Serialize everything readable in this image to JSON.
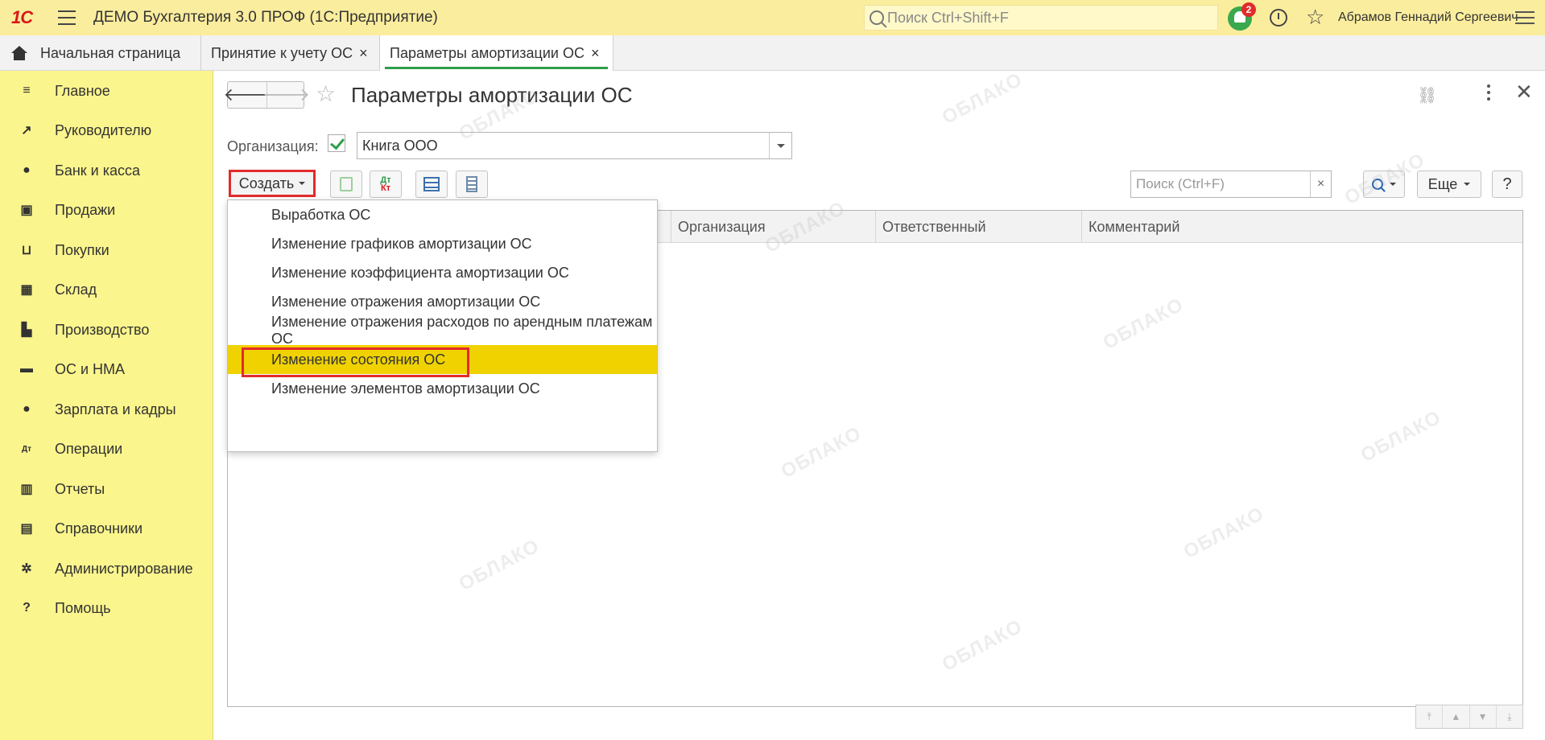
{
  "topbar": {
    "logo": "1С",
    "app_title": "ДЕМО Бухгалтерия 3.0 ПРОФ  (1С:Предприятие)",
    "search_placeholder": "Поиск Ctrl+Shift+F",
    "notifications_count": "2",
    "user_name": "Абрамов Геннадий Сергеевич"
  },
  "tabs": [
    {
      "label": "Начальная страница"
    },
    {
      "label": "Принятие к учету ОС",
      "close": "×"
    },
    {
      "label": "Параметры амортизации ОС",
      "close": "×",
      "active": true
    }
  ],
  "sidebar": {
    "items": [
      {
        "label": "Главное",
        "icon": "menu-icon"
      },
      {
        "label": "Руководителю",
        "icon": "trend-icon"
      },
      {
        "label": "Банк и касса",
        "icon": "coin-icon"
      },
      {
        "label": "Продажи",
        "icon": "bag-icon"
      },
      {
        "label": "Покупки",
        "icon": "cart-icon"
      },
      {
        "label": "Склад",
        "icon": "grid-icon"
      },
      {
        "label": "Производство",
        "icon": "factory-icon"
      },
      {
        "label": "ОС и НМА",
        "icon": "truck-icon"
      },
      {
        "label": "Зарплата и кадры",
        "icon": "person-icon"
      },
      {
        "label": "Операции",
        "icon": "dt-kt-icon"
      },
      {
        "label": "Отчеты",
        "icon": "bar-chart-icon"
      },
      {
        "label": "Справочники",
        "icon": "book-icon"
      },
      {
        "label": "Администрирование",
        "icon": "gear-icon"
      },
      {
        "label": "Помощь",
        "icon": "question-icon"
      }
    ]
  },
  "form": {
    "title": "Параметры амортизации ОС",
    "org_label": "Организация:",
    "org_checked": true,
    "org_value": "Книга ООО",
    "create_label": "Создать",
    "search_placeholder": "Поиск (Ctrl+F)",
    "search_clear": "×",
    "more_label": "Еще",
    "help_label": "?",
    "dtkt_top": "Дт",
    "dtkt_bottom": "Кт"
  },
  "table": {
    "columns": [
      "Организация",
      "Ответственный",
      "Комментарий"
    ]
  },
  "dropdown": {
    "items": [
      "Выработка ОС",
      "Изменение графиков амортизации ОС",
      "Изменение коэффициента амортизации ОС",
      "Изменение отражения амортизации ОС",
      "Изменение отражения расходов по арендным платежам ОС",
      "Изменение состояния ОС",
      "Изменение элементов амортизации ОС"
    ],
    "selected_index": 5
  },
  "watermark": "ОБЛАКО",
  "colors": {
    "topbar": "#fbed9e",
    "sidebar": "#fbf58d",
    "accent_green": "#2e9d4c",
    "highlight_red": "#e22b2b",
    "selected_row": "#f0d200"
  }
}
